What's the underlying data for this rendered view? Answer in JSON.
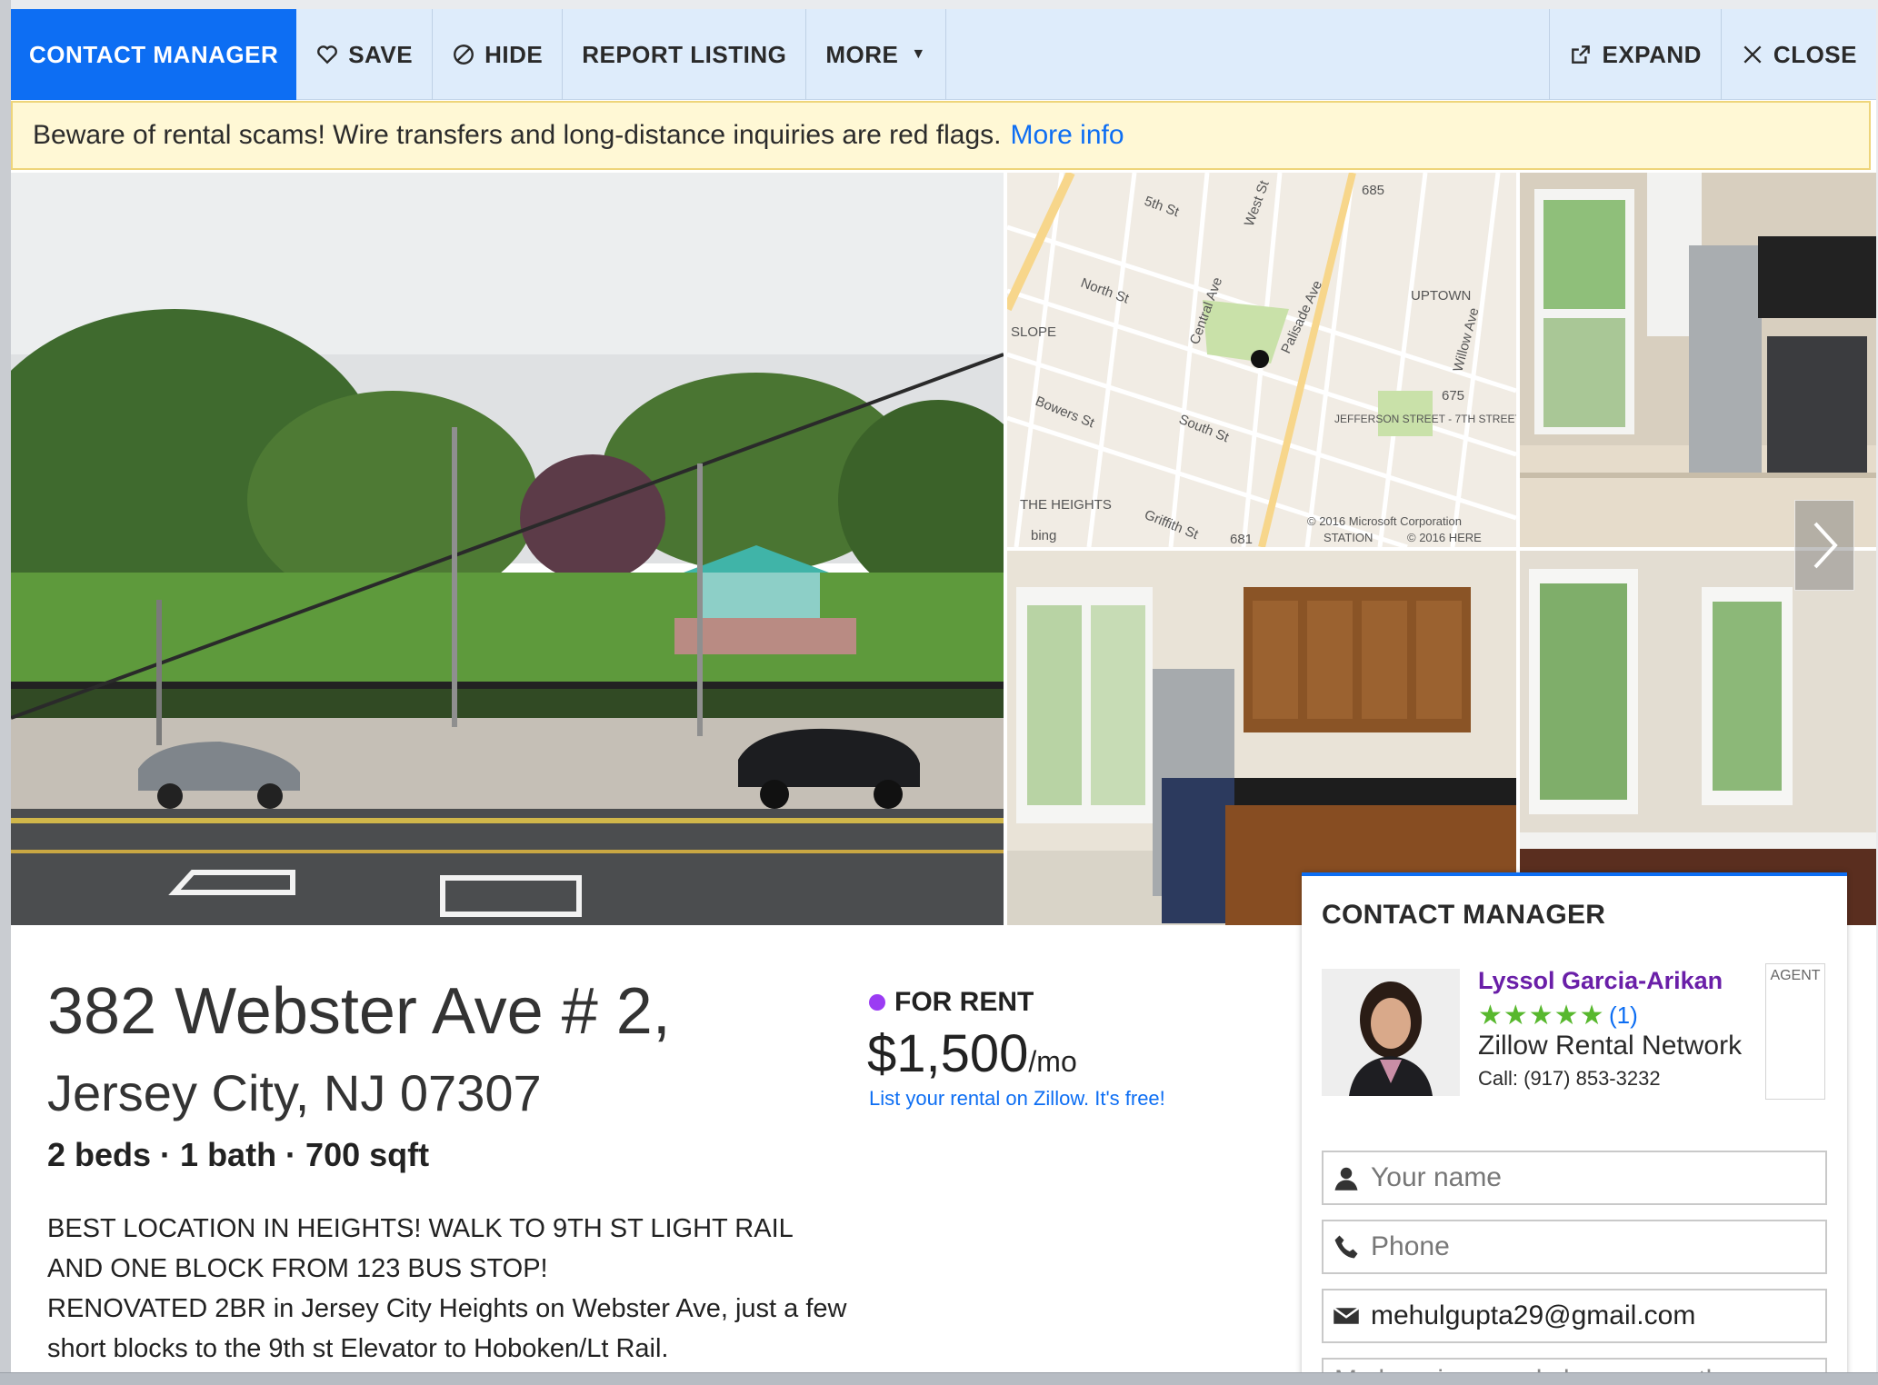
{
  "toolbar": {
    "contact_manager": "CONTACT MANAGER",
    "save": "SAVE",
    "hide": "HIDE",
    "report": "REPORT LISTING",
    "more": "MORE",
    "expand": "EXPAND",
    "close": "CLOSE"
  },
  "banner": {
    "text": "Beware of rental scams! Wire transfers and long-distance inquiries are red flags.",
    "link": "More info"
  },
  "map": {
    "labels": [
      "5th St",
      "West St",
      "685",
      "North St",
      "SLOPE",
      "Central Ave",
      "Palisade Ave",
      "UPTOWN",
      "Willow Ave",
      "675",
      "Bowers St",
      "South St",
      "JEFFERSON STREET - 7TH STREET",
      "THE HEIGHTS",
      "Griffith St",
      "681",
      "bing"
    ],
    "copyright1": "© 2016 Microsoft Corporation",
    "copyright2": "© 2016 HERE",
    "station": "STATION"
  },
  "listing": {
    "address_line1": "382 Webster Ave # 2,",
    "address_line2": "Jersey City, NJ 07307",
    "facts": "2 beds · 1 bath · 700 sqft",
    "description": [
      "BEST LOCATION IN HEIGHTS! WALK TO 9TH ST LIGHT RAIL AND ONE BLOCK FROM 123 BUS STOP!",
      "RENOVATED 2BR in Jersey City Heights on Webster Ave, just a few short blocks to the 9th st Elevator to Hoboken/Lt Rail."
    ],
    "status": "FOR RENT",
    "status_color": "#9b3cf3",
    "price": "$1,500",
    "price_unit": "/mo",
    "list_link": "List your rental on Zillow. It's free!"
  },
  "contact": {
    "title": "CONTACT MANAGER",
    "agent_name": "Lyssol Garcia-Arikan",
    "stars": "★★★★★",
    "rating": 5,
    "reviews": "(1)",
    "company": "Zillow Rental Network",
    "phone": "Call: (917) 853-3232",
    "badge": "AGENT",
    "name_placeholder": "Your name",
    "phone_placeholder": "Phone",
    "email_value": "mehulgupta29@gmail.com",
    "message_preview": "My housing needs have recently"
  },
  "colors": {
    "accent": "#0d6ef3",
    "toolbar_bg": "#deecfb",
    "banner_bg": "#fff8d5",
    "agent_name": "#6a1fa8",
    "stars": "#58b82e"
  }
}
